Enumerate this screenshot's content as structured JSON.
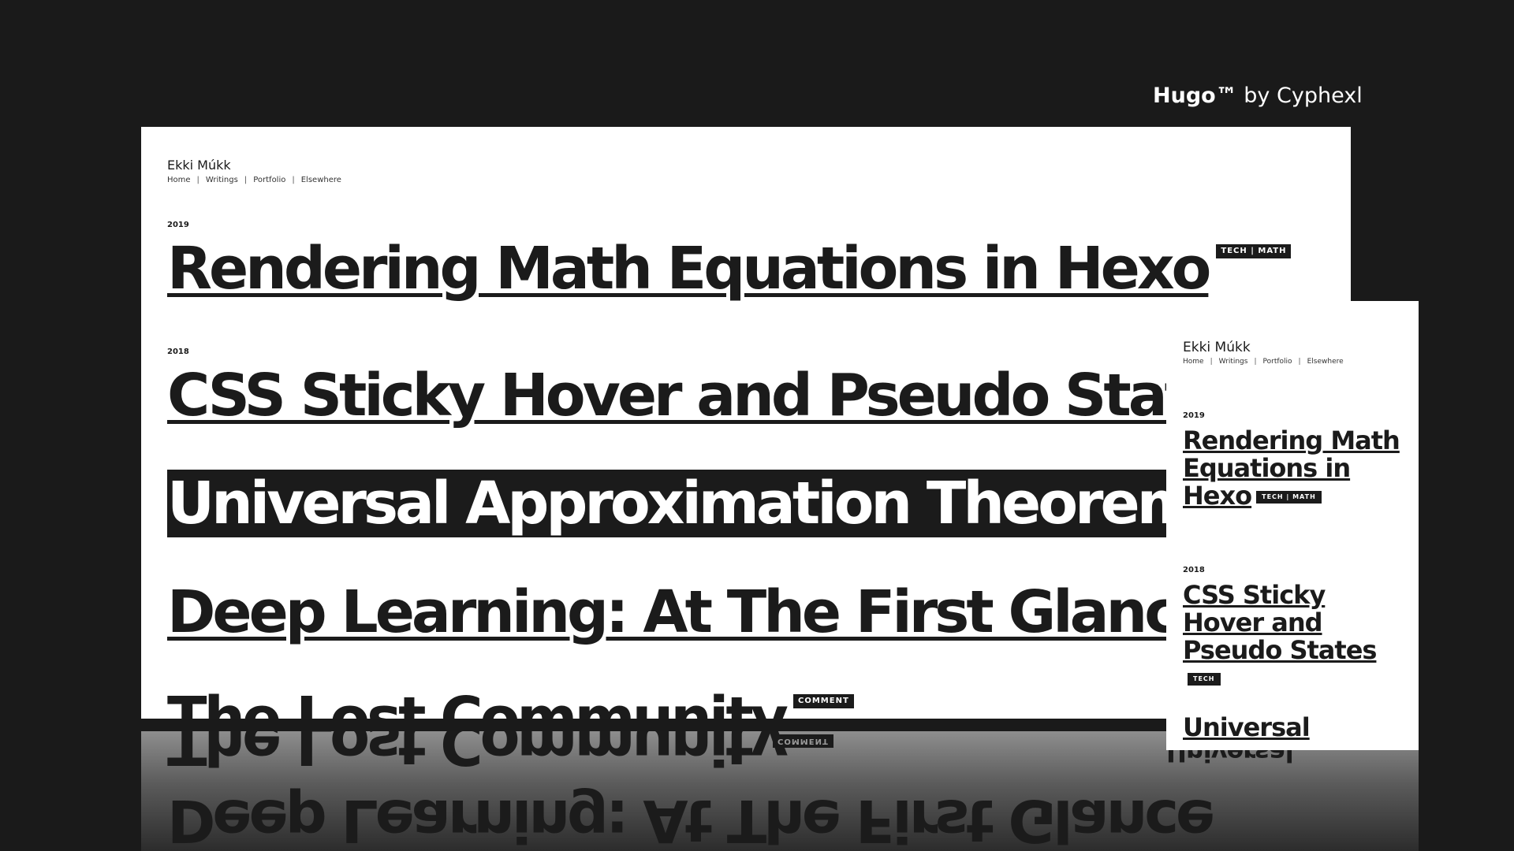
{
  "brand": {
    "name": "Hugo™",
    "by": "by Cyphexl"
  },
  "site": {
    "name": "Ekki Múkk",
    "nav": [
      "Home",
      "Writings",
      "Portfolio",
      "Elsewhere"
    ]
  },
  "desktop": {
    "posts": [
      {
        "year": "2019",
        "title": "Rendering Math Equations in Hexo",
        "tag": "TECH | MATH"
      },
      {
        "year": "2018",
        "title": "CSS Sticky Hover and Pseudo States",
        "tag": ""
      },
      {
        "year": "",
        "title": "Universal Approximation Theorem",
        "tag": ""
      },
      {
        "year": "",
        "title": "Deep Learning: At The First Glance",
        "tag": ""
      },
      {
        "year": "",
        "title": "The Lost Community",
        "tag": "COMMENT"
      }
    ],
    "hovered_index": 2
  },
  "mobile": {
    "posts": [
      {
        "year": "2019",
        "title": "Rendering Math Equations in Hexo",
        "tag": "TECH | MATH"
      },
      {
        "year": "2018",
        "title": "CSS Sticky Hover and Pseudo States",
        "tag": "TECH"
      },
      {
        "year": "",
        "title": "Universal",
        "tag": ""
      }
    ]
  },
  "reflection": {
    "desktop_titles": [
      "The Lost Community",
      "Deep Learning: At The First Glance"
    ],
    "desktop_tag": "COMMENT",
    "mobile_title": "Universal"
  }
}
